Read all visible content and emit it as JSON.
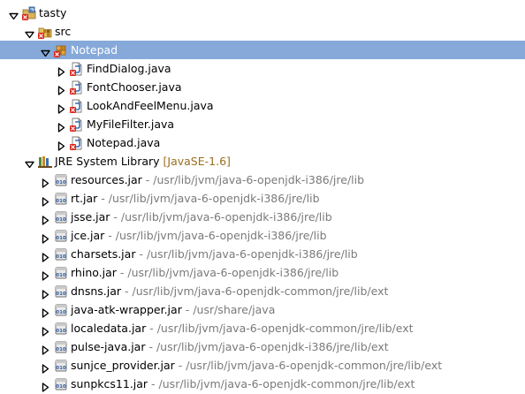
{
  "tree": {
    "items": [
      {
        "label": "tasty",
        "depth": 0,
        "expanded": true,
        "icon": "java-project-icon"
      },
      {
        "label": "src",
        "depth": 1,
        "expanded": true,
        "icon": "source-folder-icon"
      },
      {
        "label": "Notepad",
        "depth": 2,
        "expanded": true,
        "icon": "package-icon",
        "selected": true
      },
      {
        "label": "FindDialog.java",
        "depth": 3,
        "expanded": false,
        "icon": "java-file-icon"
      },
      {
        "label": "FontChooser.java",
        "depth": 3,
        "expanded": false,
        "icon": "java-file-icon"
      },
      {
        "label": "LookAndFeelMenu.java",
        "depth": 3,
        "expanded": false,
        "icon": "java-file-icon"
      },
      {
        "label": "MyFileFilter.java",
        "depth": 3,
        "expanded": false,
        "icon": "java-file-icon"
      },
      {
        "label": "Notepad.java",
        "depth": 3,
        "expanded": false,
        "icon": "java-file-icon"
      },
      {
        "label": "JRE System Library",
        "decoration": "[JavaSE-1.6]",
        "depth": 1,
        "expanded": true,
        "icon": "library-icon"
      },
      {
        "label": "resources.jar",
        "path": "/usr/lib/jvm/java-6-openjdk-i386/jre/lib",
        "depth": 2,
        "expanded": false,
        "icon": "jar-icon"
      },
      {
        "label": "rt.jar",
        "path": "/usr/lib/jvm/java-6-openjdk-i386/jre/lib",
        "depth": 2,
        "expanded": false,
        "icon": "jar-icon"
      },
      {
        "label": "jsse.jar",
        "path": "/usr/lib/jvm/java-6-openjdk-i386/jre/lib",
        "depth": 2,
        "expanded": false,
        "icon": "jar-icon"
      },
      {
        "label": "jce.jar",
        "path": "/usr/lib/jvm/java-6-openjdk-i386/jre/lib",
        "depth": 2,
        "expanded": false,
        "icon": "jar-icon"
      },
      {
        "label": "charsets.jar",
        "path": "/usr/lib/jvm/java-6-openjdk-i386/jre/lib",
        "depth": 2,
        "expanded": false,
        "icon": "jar-icon"
      },
      {
        "label": "rhino.jar",
        "path": "/usr/lib/jvm/java-6-openjdk-i386/jre/lib",
        "depth": 2,
        "expanded": false,
        "icon": "jar-icon"
      },
      {
        "label": "dnsns.jar",
        "path": "/usr/lib/jvm/java-6-openjdk-common/jre/lib/ext",
        "depth": 2,
        "expanded": false,
        "icon": "jar-icon"
      },
      {
        "label": "java-atk-wrapper.jar",
        "path": "/usr/share/java",
        "depth": 2,
        "expanded": false,
        "icon": "jar-icon"
      },
      {
        "label": "localedata.jar",
        "path": "/usr/lib/jvm/java-6-openjdk-common/jre/lib/ext",
        "depth": 2,
        "expanded": false,
        "icon": "jar-icon"
      },
      {
        "label": "pulse-java.jar",
        "path": "/usr/lib/jvm/java-6-openjdk-i386/jre/lib/ext",
        "depth": 2,
        "expanded": false,
        "icon": "jar-icon"
      },
      {
        "label": "sunjce_provider.jar",
        "path": "/usr/lib/jvm/java-6-openjdk-common/jre/lib/ext",
        "depth": 2,
        "expanded": false,
        "icon": "jar-icon"
      },
      {
        "label": "sunpkcs11.jar",
        "path": "/usr/lib/jvm/java-6-openjdk-common/jre/lib/ext",
        "depth": 2,
        "expanded": false,
        "icon": "jar-icon"
      }
    ],
    "path_separator": " - ",
    "colors": {
      "selection": "#86a9d9",
      "path_text": "#7a7a7a",
      "decoration_text": "#9a6e1e"
    }
  }
}
